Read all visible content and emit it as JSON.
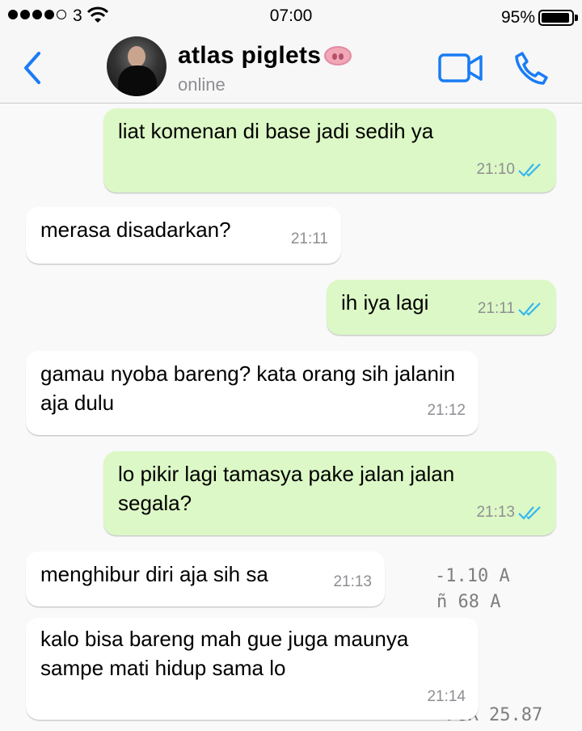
{
  "status_bar": {
    "carrier": "3",
    "time": "07:00",
    "battery": "95%"
  },
  "header": {
    "contact_name": "atlas piglets",
    "status": "online"
  },
  "messages": [
    {
      "direction": "out",
      "text": "liat komenan di base jadi sedih ya",
      "time": "21:10",
      "read": true
    },
    {
      "direction": "in",
      "text": "merasa disadarkan?",
      "time": "21:11"
    },
    {
      "direction": "out",
      "text": "ih iya lagi",
      "time": "21:11",
      "read": true
    },
    {
      "direction": "in",
      "text": "gamau nyoba bareng? kata orang sih jalanin aja dulu",
      "time": "21:12"
    },
    {
      "direction": "out",
      "text": "lo pikir lagi tamasya pake jalan jalan segala?",
      "time": "21:13",
      "read": true
    },
    {
      "direction": "in",
      "text": "menghibur diri aja sih sa",
      "time": "21:13"
    },
    {
      "direction": "in",
      "text": "kalo bisa bareng mah gue juga maunya sampe mati hidup sama lo",
      "time": "21:14"
    }
  ],
  "colors": {
    "accent": "#1a7cf5",
    "outgoing_bubble": "#dcf8c6",
    "incoming_bubble": "#ffffff",
    "read_ticks": "#34b7f1"
  }
}
